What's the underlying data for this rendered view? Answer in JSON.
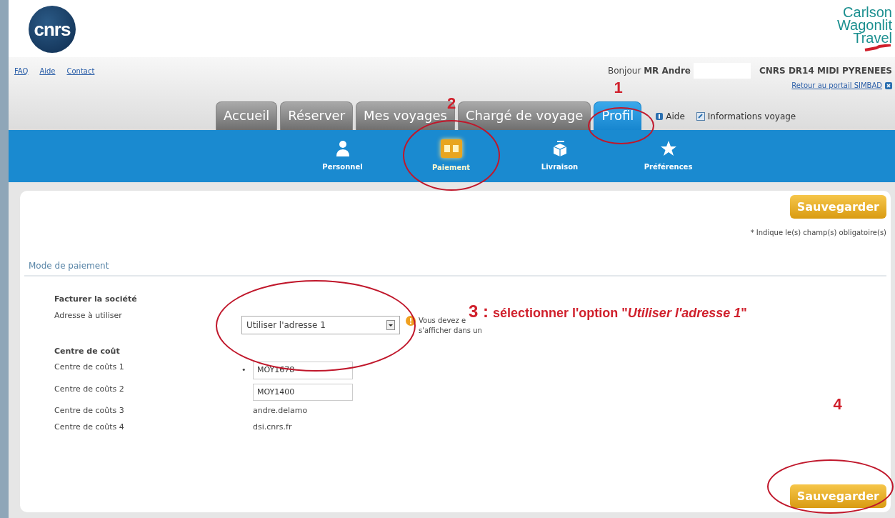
{
  "header": {
    "logo_text": "cnrs",
    "partner_logo": [
      "Carlson",
      "Wagonlit",
      "Travel"
    ]
  },
  "top_links": [
    "FAQ",
    "Aide",
    "Contact"
  ],
  "greeting": "Bonjour **MR Andre**",
  "organization": "CNRS DR14 MIDI PYRENEES",
  "portal_link": "Retour au portail SIMBAD",
  "tabs": [
    {
      "label": "Accueil",
      "selected": false
    },
    {
      "label": "Réserver",
      "selected": false
    },
    {
      "label": "Mes voyages",
      "selected": false
    },
    {
      "label": "Chargé de voyage",
      "selected": false
    },
    {
      "label": "Profil",
      "selected": true,
      "annotation": "1"
    }
  ],
  "help_links": [
    "Aide",
    "Informations voyage"
  ],
  "subnav": [
    {
      "label": "Personnel",
      "selected": false
    },
    {
      "label": "Paiement",
      "selected": true,
      "annotation": "2"
    },
    {
      "label": "Livraison",
      "selected": false
    },
    {
      "label": "Préférences",
      "selected": false
    }
  ],
  "save_top": "Sauvegarder",
  "required_note": "* Indique le(s) champ(s) obligatoire(s)",
  "section_title": "Mode de paiement",
  "groups": [
    {
      "title": "Facturer la société",
      "fields": [
        {
          "label": "Adresse à utiliser",
          "kind": "select",
          "value": "Utiliser l'adresse 1",
          "warning": [
            "Vous devez e",
            "s'afficher dans un"
          ],
          "annotation": "3 :",
          "note": "sélectionner l'option \"*Utiliser l'adresse 1*\""
        }
      ]
    },
    {
      "title": "Centre de coût",
      "fields": [
        {
          "label": "Centre de coûts 1",
          "kind": "input",
          "value": "MOY1678",
          "required_mark": "•"
        },
        {
          "label": "Centre de coûts 2",
          "kind": "input",
          "value": "MOY1400"
        },
        {
          "label": "Centre de coûts 3",
          "kind": "text",
          "value": "andre.delamo"
        },
        {
          "label": "Centre de coûts 4",
          "kind": "text",
          "value": "dsi.cnrs.fr"
        }
      ]
    }
  ],
  "save_bottom": {
    "label": "Sauvegarder",
    "annotation": "4"
  }
}
